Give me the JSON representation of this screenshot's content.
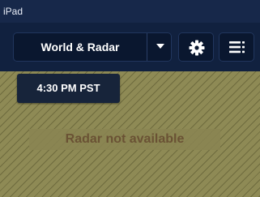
{
  "status_bar": {
    "device": "iPad"
  },
  "toolbar": {
    "layer_select": {
      "selected": "World & Radar"
    },
    "settings_icon": "gear-icon",
    "menu_icon": "list-menu-icon"
  },
  "map": {
    "time": "4:30 PM PST",
    "radar_message": "Radar not available"
  },
  "colors": {
    "status_bar": "#17284a",
    "toolbar": "#11213f",
    "button": "#0a172f",
    "map": "#8e8a55",
    "radar_message_text": "#6a5234"
  }
}
